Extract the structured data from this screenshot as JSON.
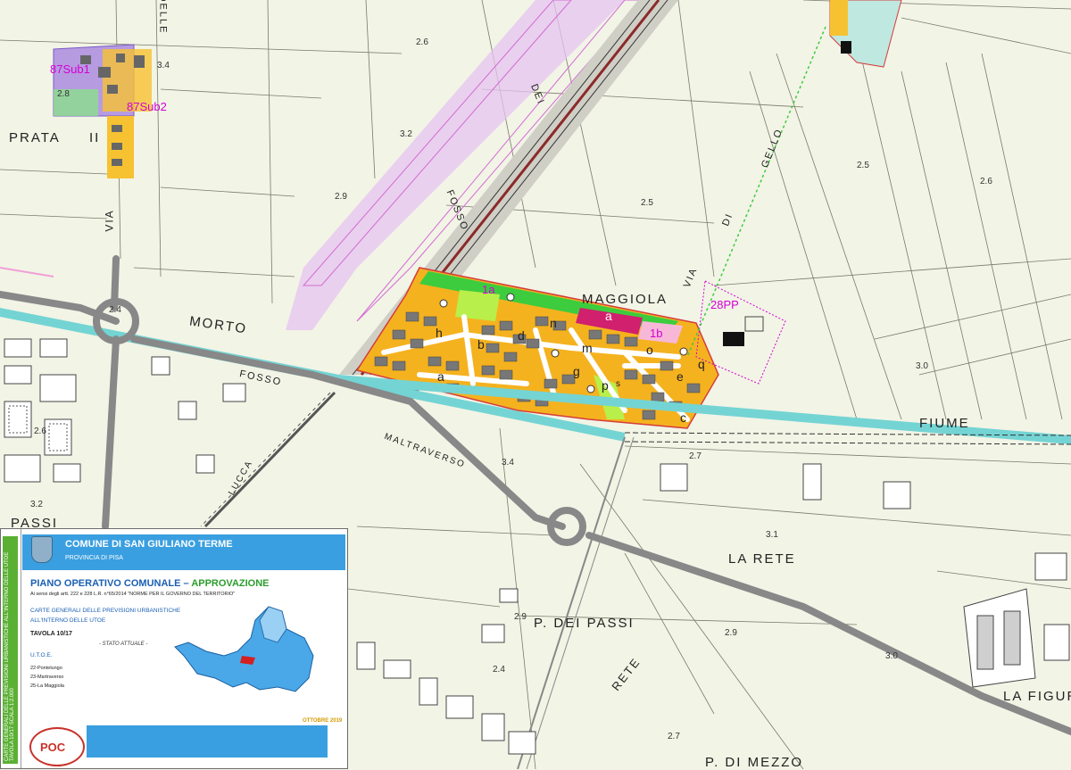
{
  "map": {
    "road_names": {
      "prata": "PRATA",
      "prata_ii": "II",
      "via_delle": "DELLE",
      "via_left": "VIA",
      "morto": "MORTO",
      "fosso_top": "FOSSO",
      "dei": "DEI",
      "via_right": "VIA",
      "di": "DI",
      "gello": "GELLO",
      "fosso_mid": "FOSSO",
      "fiume": "FIUME",
      "maltraverso": "MALTRAVERSO",
      "lucca": "LUCCA",
      "passi_left": "PASSI",
      "la_rete": "LA RETE",
      "p_dei_passi": "P.  DEI  PASSI",
      "rete_vert": "RETE",
      "la_figur": "LA  FIGUR",
      "p_di_mezzo": "P.  DI  MEZZO",
      "maggiola": "MAGGIOLA"
    },
    "zones": {
      "z87sub1": "87Sub1",
      "z87sub2": "87Sub2",
      "z1a": "1a",
      "z1b": "1b",
      "z28pp": "28PP"
    },
    "elevations": {
      "e1": "2.6",
      "e2": "3.4",
      "e3": "2.8",
      "e4": "3.2",
      "e5": "2.9",
      "e6": "2.5",
      "e7": "2.5",
      "e8": "2.6",
      "e9": "3.0",
      "e10": "2.4",
      "e11": "2.6",
      "e12": "3.2",
      "e13": "3.4",
      "e14": "2.7",
      "e15": "3.1",
      "e16": "2.9",
      "e17": "2.9",
      "e18": "2.4",
      "e19": "3.0",
      "e20": "2.7"
    },
    "lots": {
      "a1": "a",
      "a2": "a",
      "b": "b",
      "c": "c",
      "d": "d",
      "e": "e",
      "g": "g",
      "h": "h",
      "m": "m",
      "n": "n",
      "o": "o",
      "p": "p",
      "q": "q",
      "s": "s"
    }
  },
  "legend": {
    "side_text": "CARTE GENERALI DELLE PREVISIONI URBANISTICHE ALL'INTERNO DELLE UTOE  TAVOLA 10/17  SCALA 1:2.000",
    "comune": "COMUNE DI SAN GIULIANO TERME",
    "provincia": "PROVINCIA DI PISA",
    "piano": "PIANO OPERATIVO COMUNALE –",
    "approvazione": "APPROVAZIONE",
    "ai_sensi": "Ai sensi degli artt. 222 e 228 L.R. n°65/2014 \"NORME PER IL GOVERNO DEL TERRITORIO\"",
    "carte": "CARTE GENERALI DELLE PREVISIONI URBANISTICHE",
    "interno": "ALL'INTERNO DELLE UTOE",
    "tavola": "TAVOLA 10/17",
    "stato": "- STATO ATTUALE -",
    "utoe_title": "U.T.O.E.",
    "utoe_22": "22-Pontelungo",
    "utoe_23": "23-Martraverso",
    "utoe_25": "25-La Maggiola",
    "scala": "SCALA 1:2.000",
    "data": "OTTOBRE 2019",
    "logo": "POC"
  }
}
